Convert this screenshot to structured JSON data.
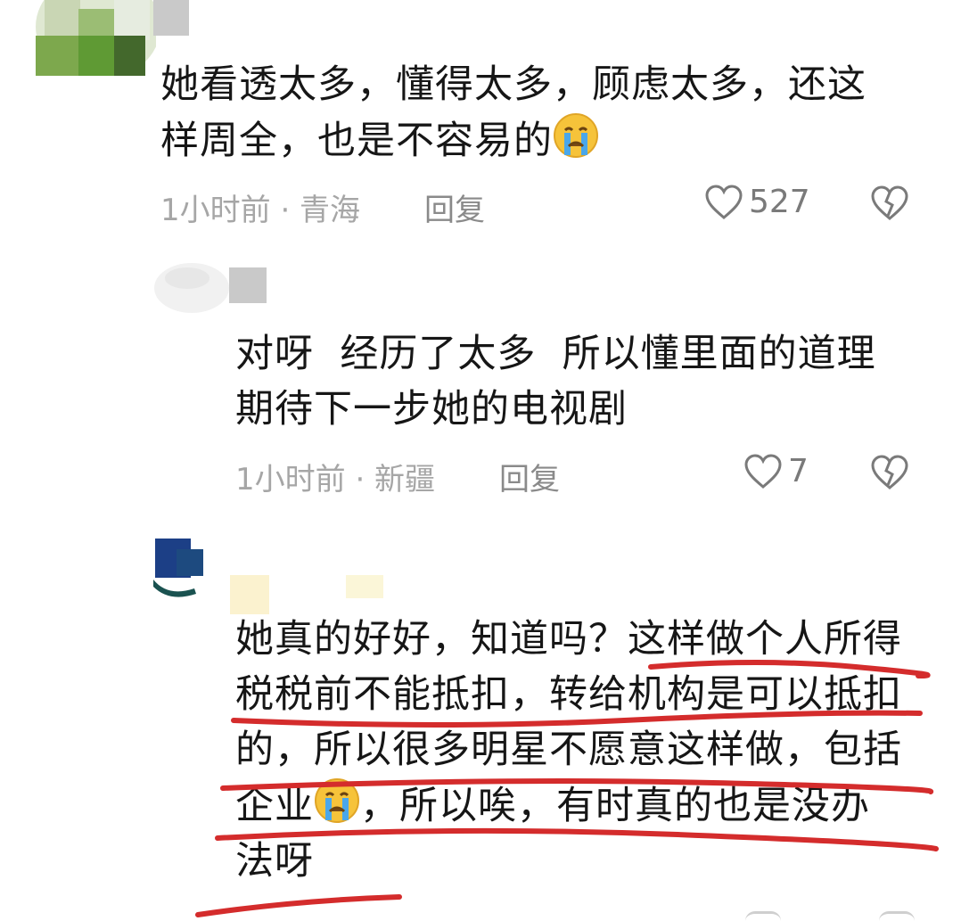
{
  "comments": [
    {
      "text_lines": [
        "她看透太多，懂得太多，顾虑太多，还这",
        "样周全，也是不容易的"
      ],
      "emoji": "crying-face",
      "time_location": "1小时前 · 青海",
      "reply_label": "回复",
      "likes": "527"
    },
    {
      "text_lines": [
        "对呀  经历了太多  所以懂里面的道理",
        "期待下一步她的电视剧"
      ],
      "time_location": "1小时前 · 新疆",
      "reply_label": "回复",
      "likes": "7"
    },
    {
      "text_lines": [
        "她真的好好，知道吗？这样做个人所得",
        "税税前不能抵扣，转给机构是可以抵扣",
        "的，所以很多明星不愿意这样做，包括",
        "企业",
        "，所以唉，有时真的也是没办",
        "法呀"
      ],
      "emoji": "crying-face"
    }
  ],
  "colors": {
    "annotation": "#d42c2c",
    "meta": "#a6a6a6",
    "text": "#161616"
  },
  "icons": {
    "like": "heart-outline-icon",
    "dislike": "broken-heart-outline-icon"
  }
}
